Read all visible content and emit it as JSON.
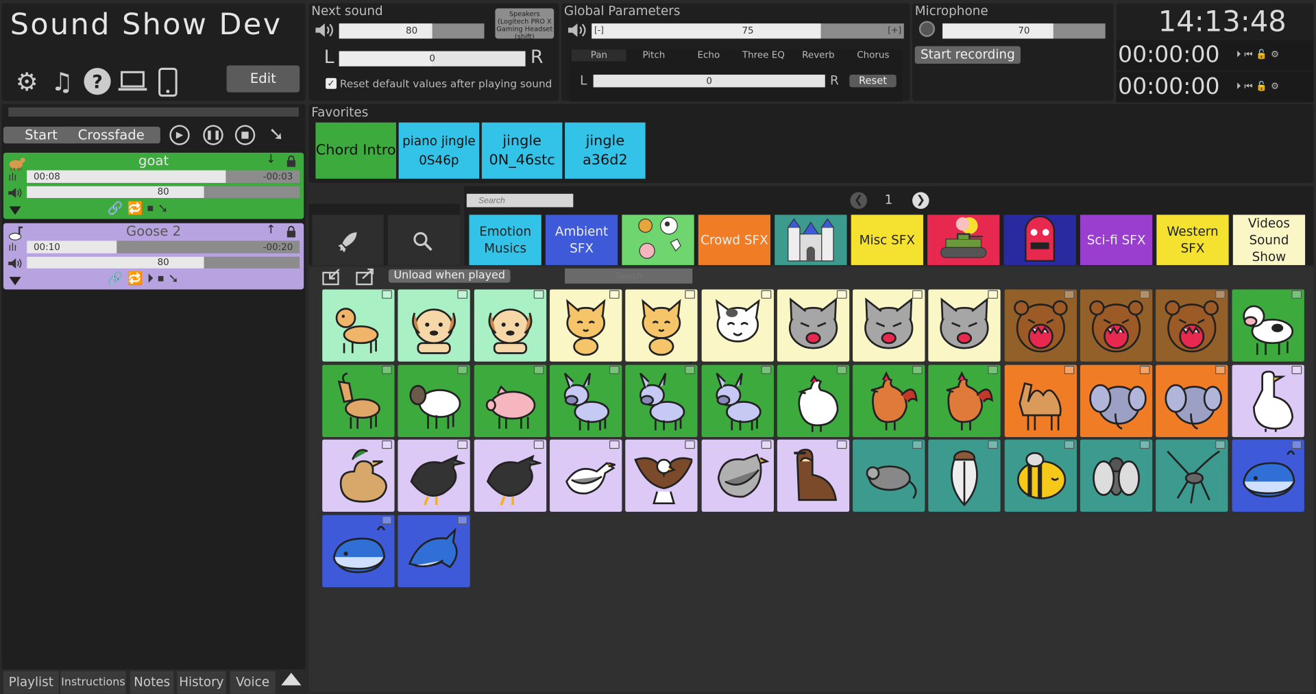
{
  "app": {
    "title": "Sound Show Dev",
    "edit": "Edit"
  },
  "next_sound": {
    "title": "Next sound",
    "volume": 80,
    "volume_label": "80",
    "pan": 0,
    "pan_label": "0",
    "left": "L",
    "right": "R",
    "device": "Speakers (Logitech PRO X Gaming Headset (shift)",
    "reset_default": "Reset default values after playing sound"
  },
  "global": {
    "title": "Global Parameters",
    "minus": "[-]",
    "plus": "[+]",
    "volume": 75,
    "volume_label": "75",
    "tabs": [
      "Pan",
      "Pitch",
      "Echo",
      "Three EQ",
      "Reverb",
      "Chorus"
    ],
    "pan_label": "0",
    "left": "L",
    "right": "R",
    "reset": "Reset"
  },
  "mic": {
    "title": "Microphone",
    "level": 70,
    "level_label": "70",
    "start_recording": "Start recording"
  },
  "clock": {
    "time": "14:13:48",
    "timer1": "00:00:00",
    "timer2": "00:00:00"
  },
  "playlist": {
    "start": "Start",
    "crossfade": "Crossfade",
    "tracks": [
      {
        "name": "goat",
        "elapsed": "00:08",
        "remaining": "-00:03",
        "progress": 0.73,
        "volume": 80,
        "volume_label": "80",
        "color": "#3daa3d"
      },
      {
        "name": "Goose 2",
        "elapsed": "00:10",
        "remaining": "-00:20",
        "progress": 0.33,
        "volume": 80,
        "volume_label": "80",
        "color": "#b7a3e0"
      }
    ]
  },
  "bottom_tabs": [
    "Playlist",
    "Instructions",
    "Notes",
    "History",
    "Voice"
  ],
  "favorites": {
    "title": "Favorites",
    "items": [
      {
        "label": "Chord Intro",
        "color": "#3daa3d"
      },
      {
        "label": "piano jingle 0S46p",
        "color": "#33c3e8"
      },
      {
        "label": "jingle 0N_46stc",
        "color": "#33c3e8"
      },
      {
        "label": "jingle a36d2",
        "color": "#33c3e8"
      }
    ]
  },
  "search": {
    "placeholder": "Search",
    "page": "1",
    "placeholder2": "Search",
    "unload": "Unload when played"
  },
  "categories": [
    {
      "label": "Emotion Musics",
      "color": "#33c3e8",
      "icon": ""
    },
    {
      "label": "Ambient SFX",
      "color": "#3e5ad8",
      "icon": ""
    },
    {
      "label": "",
      "color": "#6fd66f",
      "icon": "farm-animals-icon"
    },
    {
      "label": "Crowd SFX",
      "color": "#f07d25",
      "icon": ""
    },
    {
      "label": "",
      "color": "#3d9a8e",
      "icon": "castle-icon"
    },
    {
      "label": "Misc SFX",
      "color": "#f5e230",
      "icon": ""
    },
    {
      "label": "",
      "color": "#e8294f",
      "icon": "tank-icon"
    },
    {
      "label": "",
      "color": "#2a2aa0",
      "icon": "monster-icon"
    },
    {
      "label": "Sci-fi SFX",
      "color": "#9a3ed0",
      "icon": ""
    },
    {
      "label": "Western SFX",
      "color": "#f5e230",
      "icon": ""
    },
    {
      "label": "Videos Sound Show",
      "color": "#fbf6c6",
      "icon": ""
    }
  ],
  "sounds": [
    {
      "name": "dog-barking-icon",
      "bg": "#a9f1c4"
    },
    {
      "name": "dog-growl-icon",
      "bg": "#a9f1c4"
    },
    {
      "name": "dog-crying-icon",
      "bg": "#a9f1c4"
    },
    {
      "name": "cat-icon",
      "bg": "#fbf6c6"
    },
    {
      "name": "cat-icon",
      "bg": "#fbf6c6"
    },
    {
      "name": "cat-happy-icon",
      "bg": "#fbf6c6"
    },
    {
      "name": "cat-angry-icon",
      "bg": "#fbf6c6"
    },
    {
      "name": "cat-angry-icon",
      "bg": "#fbf6c6"
    },
    {
      "name": "cat-angry-icon",
      "bg": "#fbf6c6"
    },
    {
      "name": "bear-icon",
      "bg": "#93602a"
    },
    {
      "name": "bear-icon",
      "bg": "#93602a"
    },
    {
      "name": "bear-icon",
      "bg": "#93602a"
    },
    {
      "name": "cow-icon",
      "bg": "#3daa3d"
    },
    {
      "name": "goat-icon",
      "bg": "#3daa3d"
    },
    {
      "name": "sheep-icon",
      "bg": "#3daa3d"
    },
    {
      "name": "pig-icon",
      "bg": "#3daa3d"
    },
    {
      "name": "donkey-icon",
      "bg": "#3daa3d"
    },
    {
      "name": "donkey-icon",
      "bg": "#3daa3d"
    },
    {
      "name": "donkey-icon",
      "bg": "#3daa3d"
    },
    {
      "name": "chicken-icon",
      "bg": "#3daa3d"
    },
    {
      "name": "rooster-icon",
      "bg": "#3daa3d"
    },
    {
      "name": "rooster-icon",
      "bg": "#3daa3d"
    },
    {
      "name": "camel-icon",
      "bg": "#f07d25"
    },
    {
      "name": "elephant-icon",
      "bg": "#f07d25"
    },
    {
      "name": "elephant-icon",
      "bg": "#f07d25"
    },
    {
      "name": "goose-icon",
      "bg": "#dcc9f5"
    },
    {
      "name": "duck-icon",
      "bg": "#dcc9f5"
    },
    {
      "name": "crow-icon",
      "bg": "#dcc9f5"
    },
    {
      "name": "crow-icon",
      "bg": "#dcc9f5"
    },
    {
      "name": "seagull-icon",
      "bg": "#dcc9f5"
    },
    {
      "name": "eagle-icon",
      "bg": "#dcc9f5"
    },
    {
      "name": "pigeon-icon",
      "bg": "#dcc9f5"
    },
    {
      "name": "vulture-icon",
      "bg": "#dcc9f5"
    },
    {
      "name": "rat-icon",
      "bg": "#3d9a8e"
    },
    {
      "name": "cicada-icon",
      "bg": "#3d9a8e"
    },
    {
      "name": "bee-icon",
      "bg": "#3d9a8e"
    },
    {
      "name": "fly-icon",
      "bg": "#3d9a8e"
    },
    {
      "name": "mosquito-icon",
      "bg": "#3d9a8e"
    },
    {
      "name": "whale-icon",
      "bg": "#3e5ad8"
    },
    {
      "name": "whale-icon",
      "bg": "#3e5ad8"
    },
    {
      "name": "dolphin-icon",
      "bg": "#3e5ad8"
    }
  ]
}
